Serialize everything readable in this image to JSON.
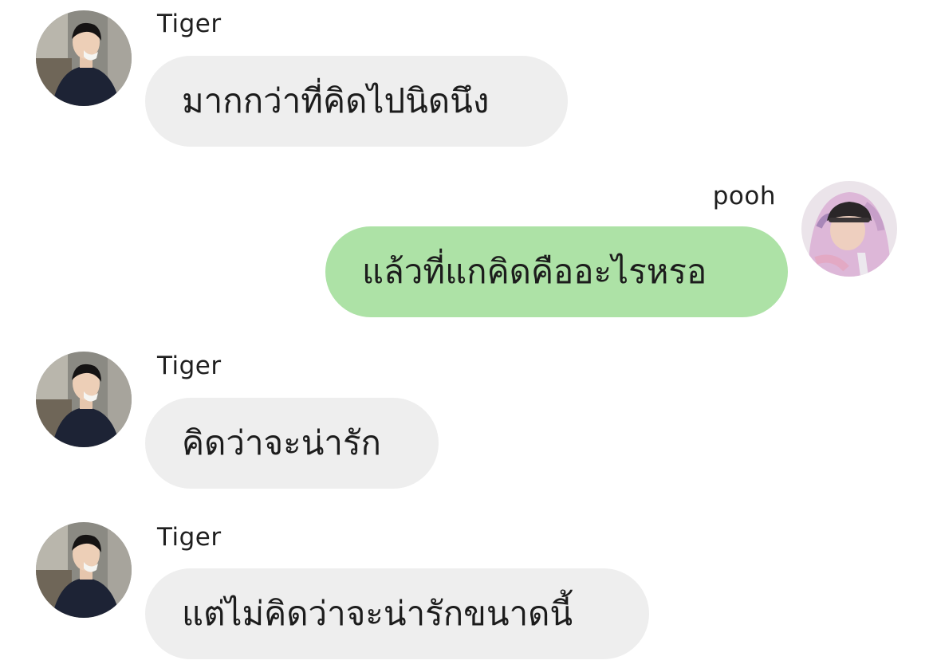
{
  "messages": [
    {
      "sender": "Tiger",
      "text": "มากกว่าที่คิดไปนิดนึง",
      "direction": "incoming",
      "avatar": "tiger-avatar"
    },
    {
      "sender": "pooh",
      "text": "แล้วที่แกคิดคืออะไรหรอ",
      "direction": "outgoing",
      "avatar": "pooh-avatar"
    },
    {
      "sender": "Tiger",
      "text": "คิดว่าจะน่ารัก",
      "direction": "incoming",
      "avatar": "tiger-avatar"
    },
    {
      "sender": "Tiger",
      "text": "แต่ไม่คิดว่าจะน่ารักขนาดนี้",
      "direction": "incoming",
      "avatar": "tiger-avatar"
    }
  ],
  "colors": {
    "incoming_bubble": "#eeeeee",
    "outgoing_bubble": "#ade2a6",
    "background": "#ffffff",
    "text": "#1c1c1c"
  }
}
